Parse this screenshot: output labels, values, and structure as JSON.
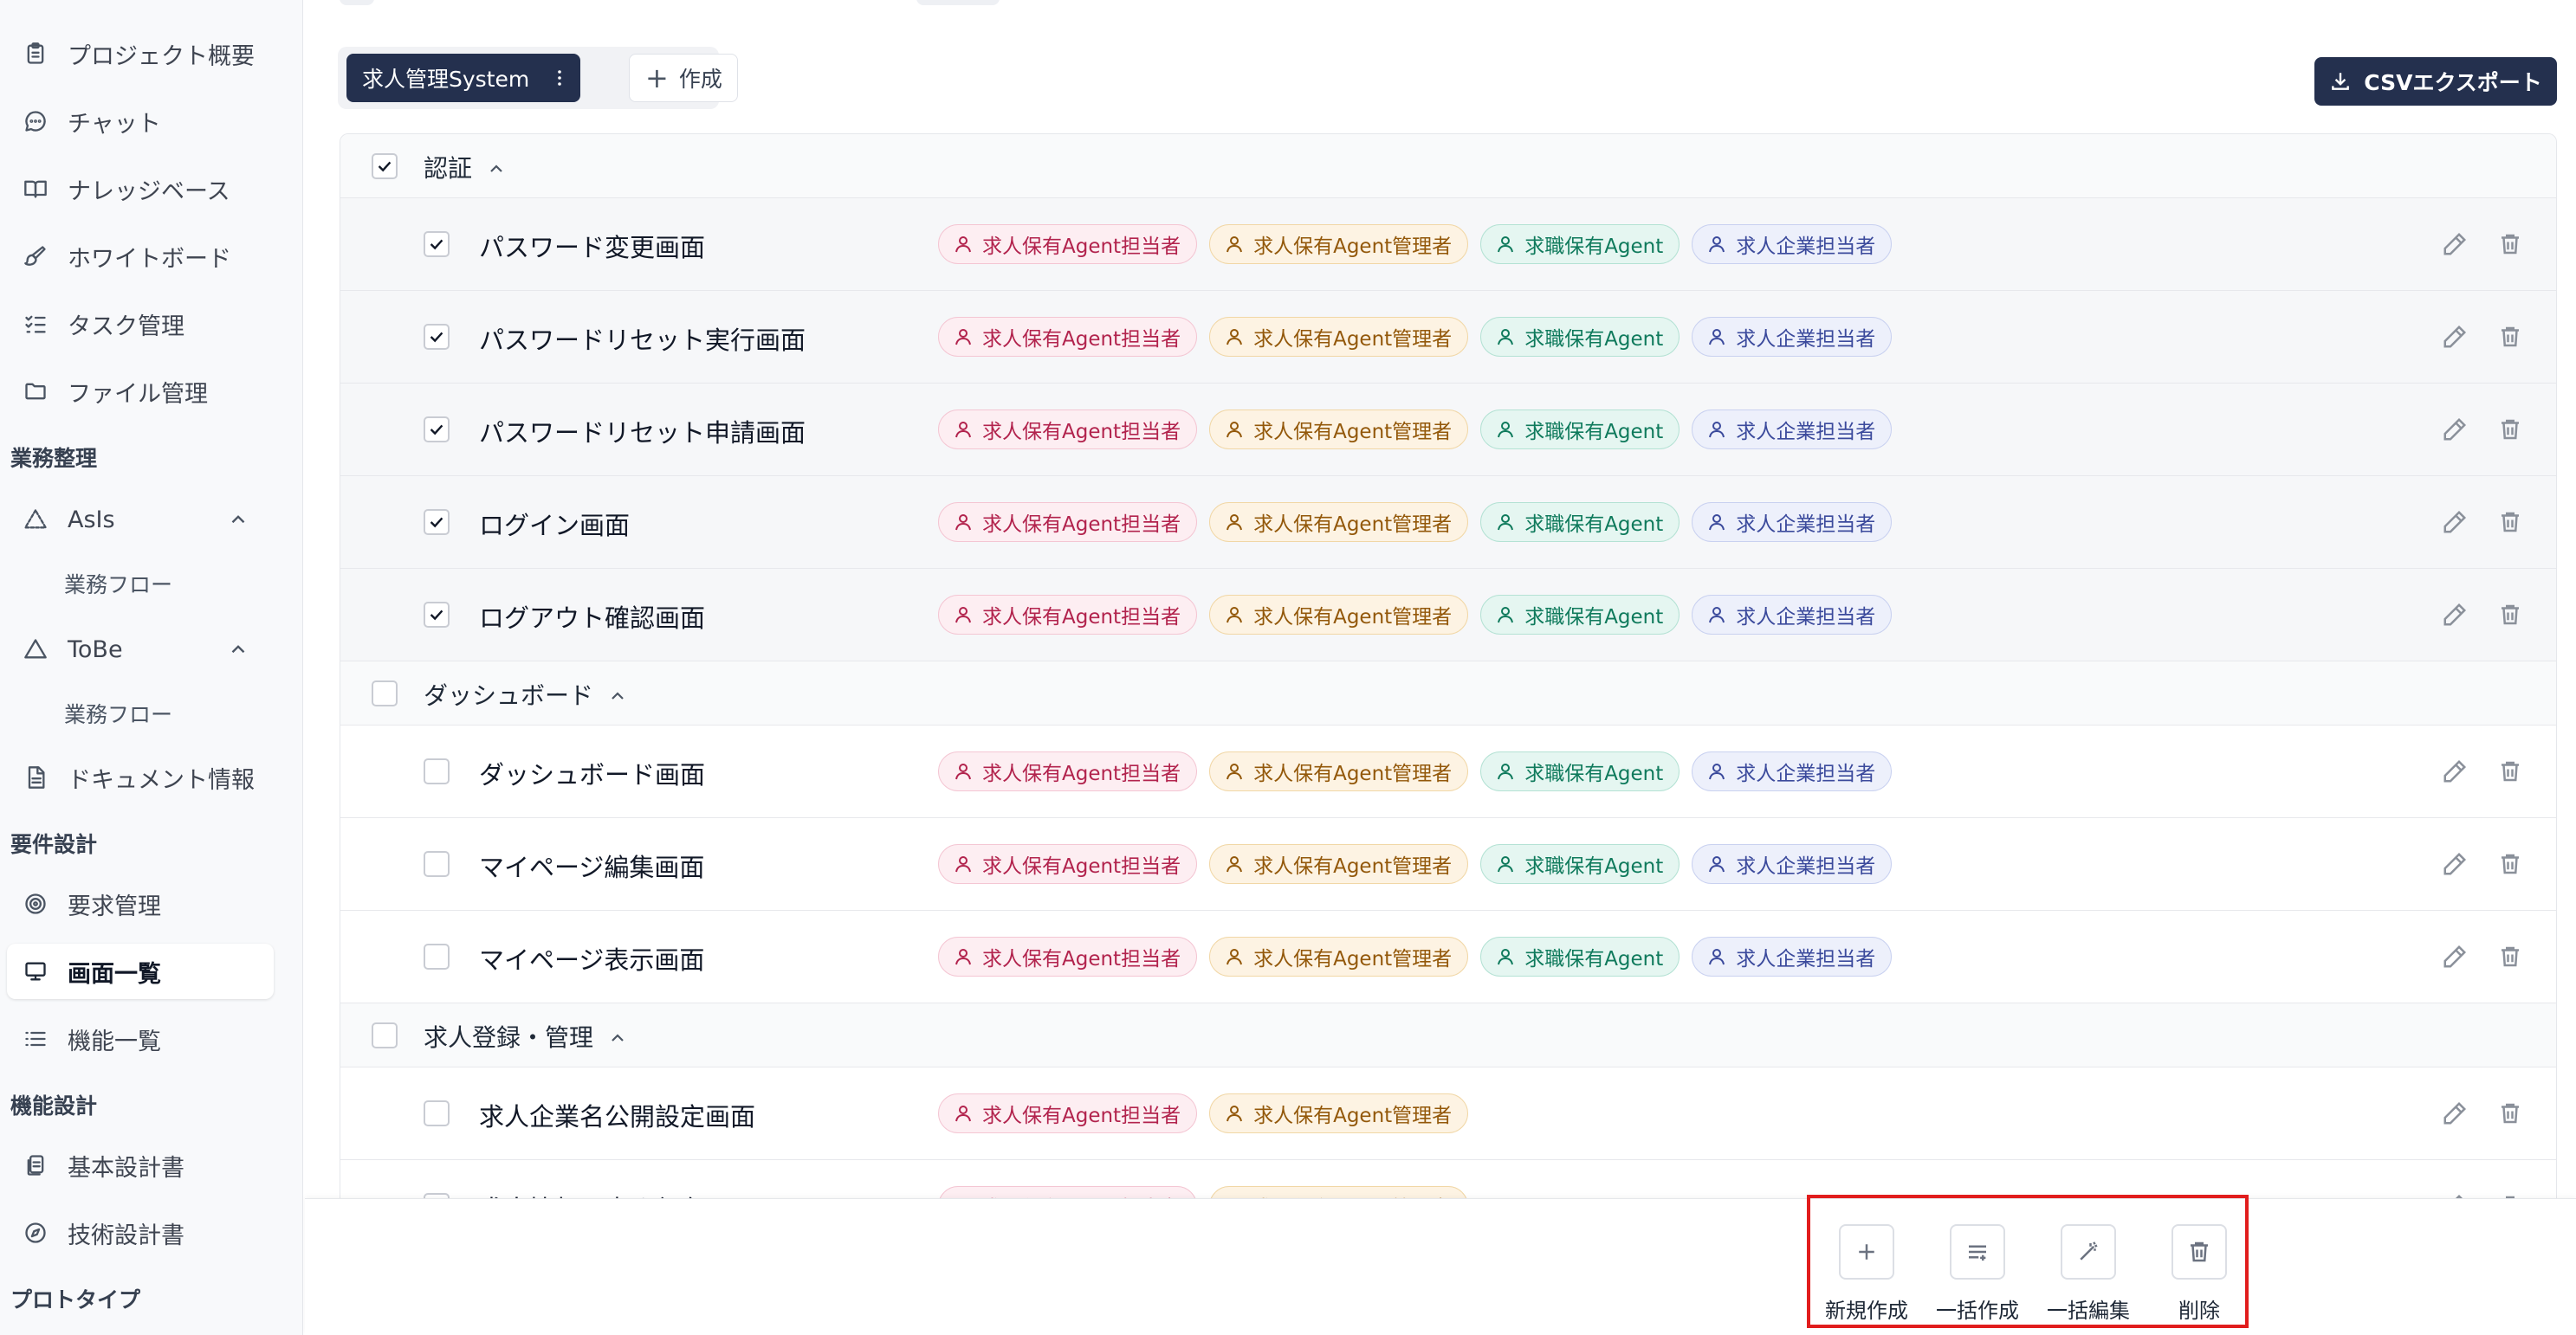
{
  "sidebar": {
    "items_top": [
      {
        "label": "プロジェクト概要",
        "icon": "clipboard-icon"
      },
      {
        "label": "チャット",
        "icon": "chat-icon"
      },
      {
        "label": "ナレッジベース",
        "icon": "book-icon"
      },
      {
        "label": "ホワイトボード",
        "icon": "brush-icon"
      },
      {
        "label": "タスク管理",
        "icon": "checklist-icon"
      },
      {
        "label": "ファイル管理",
        "icon": "folder-icon"
      }
    ],
    "section_business": "業務整理",
    "asis": {
      "label": "AsIs",
      "icon": "triangle-dashed-icon",
      "sub": "業務フロー"
    },
    "tobe": {
      "label": "ToBe",
      "icon": "triangle-icon",
      "sub": "業務フロー"
    },
    "doc_info": {
      "label": "ドキュメント情報",
      "icon": "document-icon"
    },
    "section_requirements": "要件設計",
    "requirements": {
      "label": "要求管理",
      "icon": "target-icon"
    },
    "screen_list": {
      "label": "画面一覧",
      "icon": "monitor-icon"
    },
    "function_list": {
      "label": "機能一覧",
      "icon": "list-icon"
    },
    "section_function": "機能設計",
    "basic_design": {
      "label": "基本設計書",
      "icon": "file-stack-icon"
    },
    "tech_design": {
      "label": "技術設計書",
      "icon": "compass-icon"
    },
    "section_prototype": "プロトタイプ"
  },
  "toolbar": {
    "active_tab": "求人管理System",
    "create_label": "作成",
    "csv_export_label": "CSVエクスポート"
  },
  "badge_labels": {
    "agent_staff": "求人保有Agent担当者",
    "agent_manager": "求人保有Agent管理者",
    "seeker_agent": "求職保有Agent",
    "company_staff": "求人企業担当者"
  },
  "groups": [
    {
      "label": "認証",
      "checked": true,
      "items": [
        {
          "name": "パスワード変更画面",
          "checked": true
        },
        {
          "name": "パスワードリセット実行画面",
          "checked": true
        },
        {
          "name": "パスワードリセット申請画面",
          "checked": true
        },
        {
          "name": "ログイン画面",
          "checked": true
        },
        {
          "name": "ログアウト確認画面",
          "checked": true
        }
      ]
    },
    {
      "label": "ダッシュボード",
      "checked": false,
      "items": [
        {
          "name": "ダッシュボード画面",
          "checked": false
        },
        {
          "name": "マイページ編集画面",
          "checked": false
        },
        {
          "name": "マイページ表示画面",
          "checked": false
        }
      ]
    },
    {
      "label": "求人登録・管理",
      "checked": false,
      "items": [
        {
          "name": "求人企業名公開設定画面",
          "checked": false
        },
        {
          "name": "求人情報下書き保存画面",
          "checked": false
        }
      ]
    }
  ],
  "bulk_actions": {
    "new_label": "新規作成",
    "bulk_create_label": "一括作成",
    "bulk_edit_label": "一括編集",
    "delete_label": "削除"
  },
  "colors": {
    "primary_dark": "#24304e",
    "highlight_border": "#e11d1d"
  }
}
